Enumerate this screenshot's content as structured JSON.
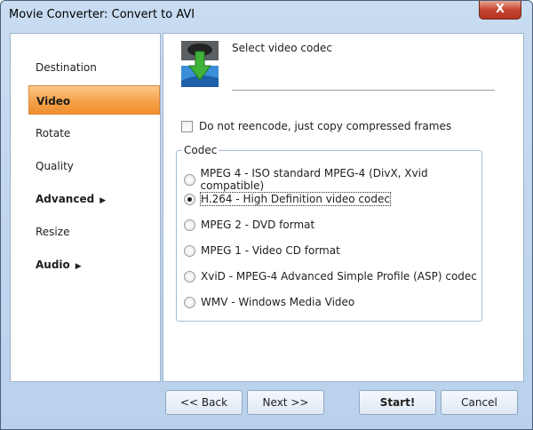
{
  "window": {
    "title": "Movie Converter:  Convert to AVI",
    "close_label": "X"
  },
  "sidebar": {
    "items": [
      {
        "label": "Destination"
      },
      {
        "label": "Video"
      },
      {
        "label": "Rotate"
      },
      {
        "label": "Quality"
      },
      {
        "label": "Advanced"
      },
      {
        "label": "Resize"
      },
      {
        "label": "Audio"
      }
    ],
    "submenu_arrow": "▶"
  },
  "main": {
    "heading": "Select video codec",
    "copy_checkbox": {
      "label": "Do not reencode, just copy compressed frames",
      "checked": false
    },
    "codec_group": {
      "label": "Codec",
      "options": [
        {
          "label": "MPEG 4 -  ISO standard MPEG-4  (DivX, Xvid compatible)",
          "selected": false
        },
        {
          "label": "H.264 - High Definition video codec",
          "selected": true
        },
        {
          "label": "MPEG 2 - DVD format",
          "selected": false
        },
        {
          "label": "MPEG 1 - Video CD format",
          "selected": false
        },
        {
          "label": "XviD - MPEG-4 Advanced Simple Profile (ASP) codec",
          "selected": false
        },
        {
          "label": "WMV - Windows Media Video",
          "selected": false
        }
      ]
    }
  },
  "buttons": {
    "back": "<< Back",
    "next": "Next >>",
    "start": "Start!",
    "cancel": "Cancel"
  }
}
